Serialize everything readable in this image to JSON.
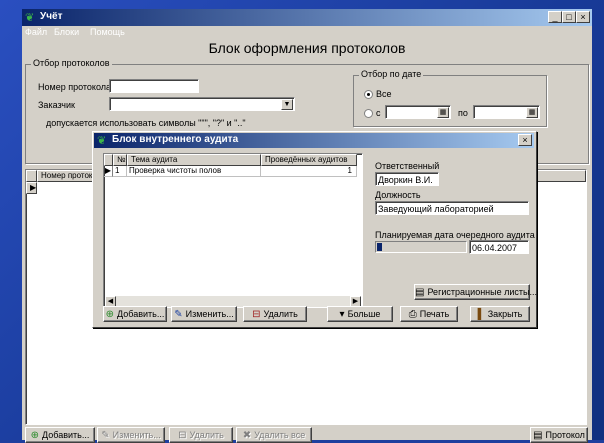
{
  "window": {
    "title": "Учёт",
    "min": "_",
    "max": "□",
    "close": "×"
  },
  "menu": [
    "Файл",
    "Блоки",
    "Помощь"
  ],
  "heading": "Блок оформления протоколов",
  "filter": {
    "legend": "Отбор протоколов",
    "protocol_label": "Номер протокола",
    "protocol_value": "",
    "customer_label": "Заказчик",
    "customer_value": "",
    "hint": "допускается использовать символы \"\"\", \"?\" и \"..\""
  },
  "date_filter": {
    "legend": "Отбор по дате",
    "all_label": "Все",
    "from_label": "с",
    "to_label": "по",
    "from_value": "",
    "to_value": ""
  },
  "main_grid": {
    "col1": "Номер протоко"
  },
  "bottom_buttons": {
    "add": "Добавить...",
    "edit": "Изменить...",
    "delete": "Удалить",
    "delete_all": "Удалить все",
    "protocol": "Протокол"
  },
  "dialog": {
    "title": "Блок внутреннего аудита",
    "close": "×",
    "columns": [
      "№",
      "Тема аудита",
      "Проведённых аудитов"
    ],
    "rows": [
      {
        "num": "1",
        "topic": "Проверка чистоты полов",
        "count": "1"
      }
    ],
    "responsible_label": "Ответственный",
    "responsible_value": "Дворкин В.И.",
    "position_label": "Должность",
    "position_value": "Заведующий лабораторией",
    "next_date_label": "Планируемая дата очередного аудита",
    "next_date_value": "06.04.2007",
    "progress": 0.05,
    "reg_button": "Регистрационные листы...",
    "buttons": {
      "add": "Добавить...",
      "edit": "Изменить...",
      "delete": "Удалить",
      "more": "Больше",
      "print": "Печать",
      "close": "Закрыть"
    }
  },
  "icons": {
    "app": "plant-icon",
    "add": "add-icon",
    "edit": "edit-icon",
    "delete": "delete-icon",
    "print": "printer-icon",
    "close": "door-icon",
    "reg": "document-icon"
  }
}
